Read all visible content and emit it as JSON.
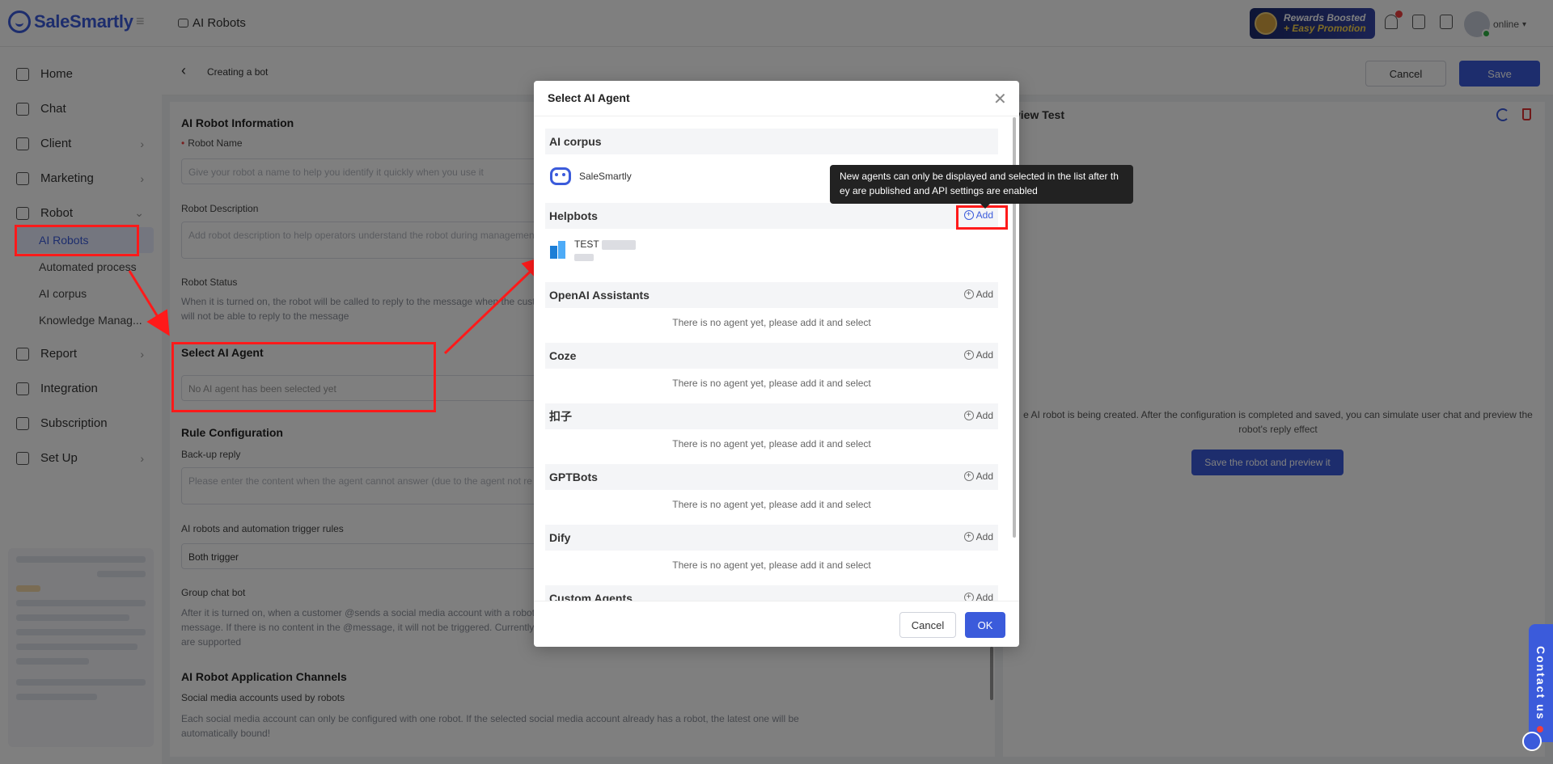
{
  "app": {
    "brand": "SaleSmartly",
    "crumb": "AI Robots"
  },
  "topbar": {
    "rewards_line1": "Rewards Boosted",
    "rewards_line2": "+ Easy Promotion",
    "user_status": "online"
  },
  "sidebar": {
    "items": [
      {
        "label": "Home",
        "icon": "home-icon"
      },
      {
        "label": "Chat",
        "icon": "chat-icon"
      },
      {
        "label": "Client",
        "icon": "users-icon"
      },
      {
        "label": "Marketing",
        "icon": "send-icon"
      },
      {
        "label": "Robot",
        "icon": "robot-icon"
      }
    ],
    "robot_sub": [
      "AI Robots",
      "Automated process",
      "AI corpus",
      "Knowledge Manag..."
    ],
    "items2": [
      {
        "label": "Report",
        "icon": "report-icon"
      },
      {
        "label": "Integration",
        "icon": "integration-icon"
      },
      {
        "label": "Subscription",
        "icon": "subscription-icon"
      },
      {
        "label": "Set Up",
        "icon": "settings-icon"
      }
    ]
  },
  "main": {
    "title": "Creating a bot",
    "cancel": "Cancel",
    "save": "Save",
    "info_title": "AI Robot Information",
    "robot_name_label": "Robot Name",
    "robot_name_placeholder": "Give your robot a name to help you identify it quickly when you use it",
    "desc_label": "Robot Description",
    "desc_placeholder": "Add robot description to help operators understand the robot during management",
    "status_label": "Robot Status",
    "status_help_1": "When it is turned on, the robot will be called to reply to the message when the cust",
    "status_help_2": "will not be able to reply to the message",
    "agent_title": "Select AI Agent",
    "agent_placeholder": "No AI agent has been selected yet",
    "rule_title": "Rule Configuration",
    "backup_label": "Back-up reply",
    "backup_placeholder": "Please enter the content when the agent cannot answer (due to the agent not re",
    "trigger_label": "AI robots and automation trigger rules",
    "trigger_value": "Both trigger",
    "group_label": "Group chat bot",
    "group_help_1": "After it is turned on, when a customer @sends a social media account with a robot",
    "group_help_2": "message. If there is no content in the @message, it will not be triggered. Currently",
    "group_help_3": "are supported",
    "channels_title": "AI Robot Application Channels",
    "channels_label": "Social media accounts used by robots",
    "channels_help_1": "Each social media account can only be configured with one robot. If the selected social media account already has a robot, the latest one will be",
    "channels_help_2": "automatically bound!"
  },
  "preview": {
    "title": "view Test",
    "text_1": "e AI robot is being created. After the configuration is completed and saved, you can simulate user chat and preview the",
    "text_2": "robot's reply effect",
    "button": "Save the robot and preview it"
  },
  "modal": {
    "title": "Select AI Agent",
    "add_label": "Add",
    "empty_text": "There is no agent yet, please add it and select",
    "ai_corpus": {
      "title": "AI corpus",
      "agent": "SaleSmartly"
    },
    "helpbots": {
      "title": "Helpbots",
      "agent": "TEST"
    },
    "groups": [
      "OpenAI Assistants",
      "Coze",
      "扣子",
      "GPTBots",
      "Dify"
    ],
    "custom": "Custom Agents",
    "cancel": "Cancel",
    "ok": "OK"
  },
  "tooltip": {
    "line1": "New agents can only be displayed and selected in the list after th",
    "line2": "ey are published and API settings are enabled"
  },
  "contact": "Contact us",
  "colors": {
    "accent": "#3b5bdb",
    "annotation": "#ff1a1a"
  }
}
